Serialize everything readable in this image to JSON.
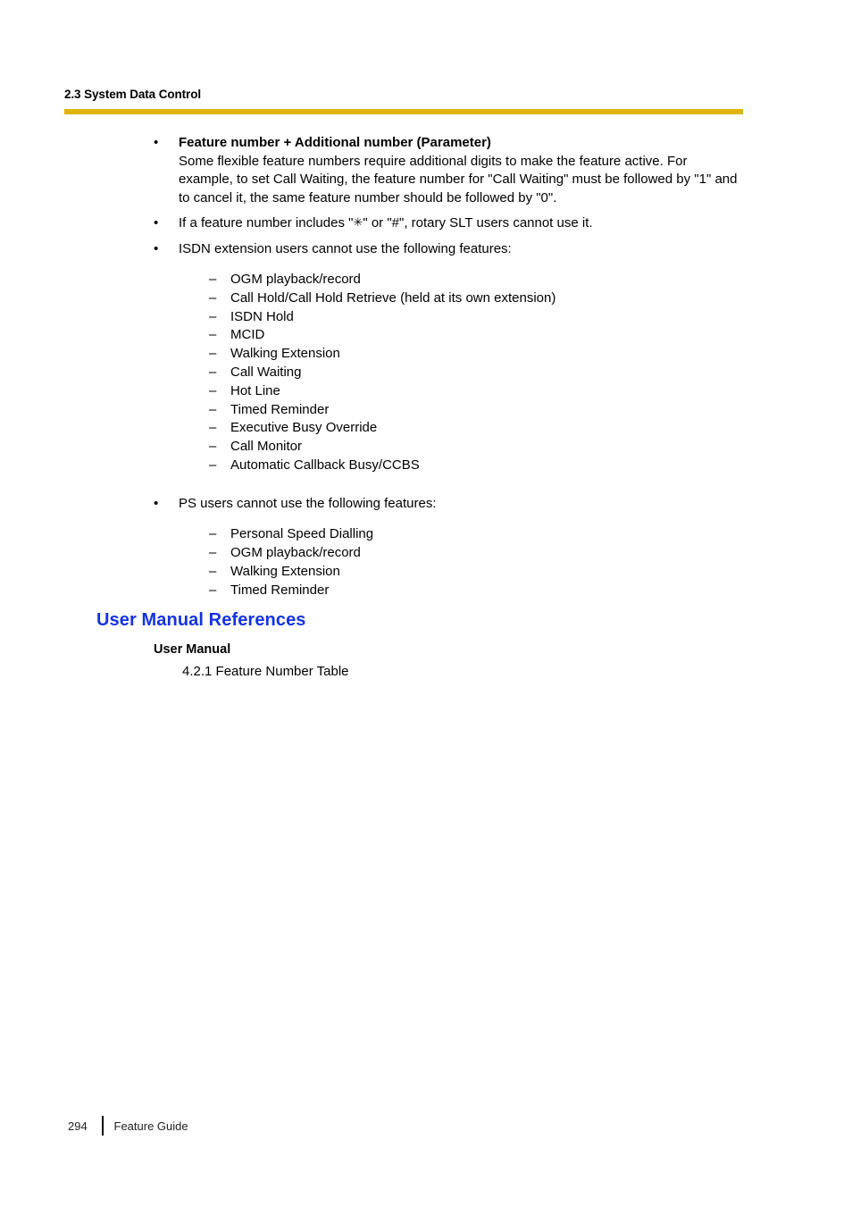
{
  "header": {
    "running_title": "2.3 System Data Control",
    "rule_color": "#deb510"
  },
  "body": {
    "bullets": [
      {
        "marker": "•",
        "heading": "Feature number + Additional number (Parameter)",
        "text": "Some flexible feature numbers require additional digits to make the feature active. For example, to set Call Waiting, the feature number for \"Call Waiting\" must be followed by \"1\" and to cancel it, the same feature number should be followed by \"0\"."
      },
      {
        "marker": "•",
        "text_before_symbol": "If a feature number includes \"",
        "symbol": "✳",
        "text_after_symbol": "\" or \"#\", rotary SLT users cannot use it."
      },
      {
        "marker": "•",
        "text": "ISDN extension users cannot use the following features:"
      },
      {
        "marker": "•",
        "text": "PS users cannot use the following features:"
      }
    ],
    "isdn_features": [
      {
        "dash": "–",
        "label": "OGM playback/record"
      },
      {
        "dash": "–",
        "label": "Call Hold/Call Hold Retrieve (held at its own extension)"
      },
      {
        "dash": "–",
        "label": "ISDN Hold"
      },
      {
        "dash": "–",
        "label": "MCID"
      },
      {
        "dash": "–",
        "label": "Walking Extension"
      },
      {
        "dash": "–",
        "label": "Call Waiting"
      },
      {
        "dash": "–",
        "label": "Hot Line"
      },
      {
        "dash": "–",
        "label": "Timed Reminder"
      },
      {
        "dash": "–",
        "label": "Executive Busy Override"
      },
      {
        "dash": "–",
        "label": "Call Monitor"
      },
      {
        "dash": "–",
        "label": "Automatic Callback Busy/CCBS"
      }
    ],
    "ps_features": [
      {
        "dash": "–",
        "label": "Personal Speed Dialling"
      },
      {
        "dash": "–",
        "label": "OGM playback/record"
      },
      {
        "dash": "–",
        "label": "Walking Extension"
      },
      {
        "dash": "–",
        "label": "Timed Reminder"
      }
    ]
  },
  "references": {
    "section_title": "User Manual References",
    "section_title_color": "#1433e0",
    "sub_heading": "User Manual",
    "entry": "4.2.1 Feature Number Table"
  },
  "footer": {
    "page_number": "294",
    "guide_title": "Feature Guide"
  }
}
